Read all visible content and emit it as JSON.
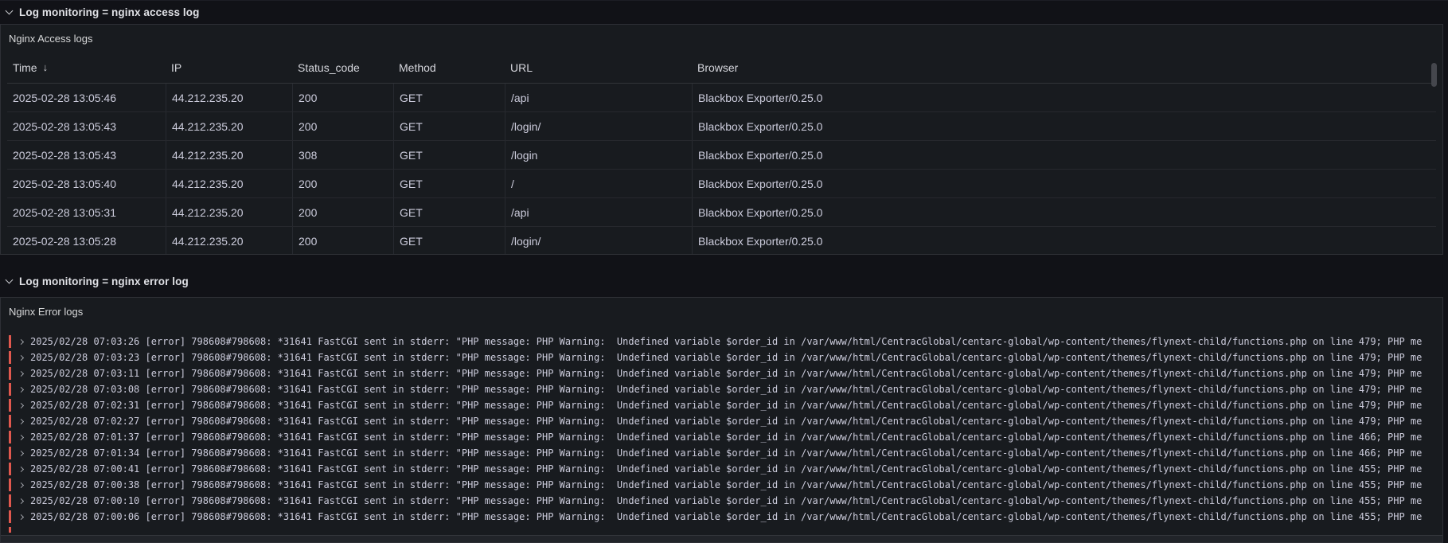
{
  "colors": {
    "error_level_bar": "#e0584e",
    "panel_background": "#181b1f",
    "page_background": "#111217"
  },
  "icons": {
    "sort_desc": "↓",
    "row_chevron": "chevron-down",
    "log_chevron": "chevron-right"
  },
  "access_section": {
    "row_header": "Log monitoring = nginx access log",
    "panel_title": "Nginx Access logs",
    "table": {
      "columns": [
        "Time",
        "IP",
        "Status_code",
        "Method",
        "URL",
        "Browser"
      ],
      "sorted_column_index": 0,
      "sort_direction": "desc",
      "rows": [
        [
          "2025-02-28 13:05:46",
          "44.212.235.20",
          "200",
          "GET",
          "/api",
          "Blackbox Exporter/0.25.0"
        ],
        [
          "2025-02-28 13:05:43",
          "44.212.235.20",
          "200",
          "GET",
          "/login/",
          "Blackbox Exporter/0.25.0"
        ],
        [
          "2025-02-28 13:05:43",
          "44.212.235.20",
          "308",
          "GET",
          "/login",
          "Blackbox Exporter/0.25.0"
        ],
        [
          "2025-02-28 13:05:40",
          "44.212.235.20",
          "200",
          "GET",
          "/",
          "Blackbox Exporter/0.25.0"
        ],
        [
          "2025-02-28 13:05:31",
          "44.212.235.20",
          "200",
          "GET",
          "/api",
          "Blackbox Exporter/0.25.0"
        ],
        [
          "2025-02-28 13:05:28",
          "44.212.235.20",
          "200",
          "GET",
          "/login/",
          "Blackbox Exporter/0.25.0"
        ]
      ]
    }
  },
  "error_section": {
    "row_header": "Log monitoring = nginx error log",
    "panel_title": "Nginx Error logs",
    "log_level": "error",
    "lines": [
      "2025/02/28 07:03:26 [error] 798608#798608: *31641 FastCGI sent in stderr: \"PHP message: PHP Warning:  Undefined variable $order_id in /var/www/html/CentracGlobal/centarc-global/wp-content/themes/flynext-child/functions.php on line 479; PHP me",
      "2025/02/28 07:03:23 [error] 798608#798608: *31641 FastCGI sent in stderr: \"PHP message: PHP Warning:  Undefined variable $order_id in /var/www/html/CentracGlobal/centarc-global/wp-content/themes/flynext-child/functions.php on line 479; PHP me",
      "2025/02/28 07:03:11 [error] 798608#798608: *31641 FastCGI sent in stderr: \"PHP message: PHP Warning:  Undefined variable $order_id in /var/www/html/CentracGlobal/centarc-global/wp-content/themes/flynext-child/functions.php on line 479; PHP me",
      "2025/02/28 07:03:08 [error] 798608#798608: *31641 FastCGI sent in stderr: \"PHP message: PHP Warning:  Undefined variable $order_id in /var/www/html/CentracGlobal/centarc-global/wp-content/themes/flynext-child/functions.php on line 479; PHP me",
      "2025/02/28 07:02:31 [error] 798608#798608: *31641 FastCGI sent in stderr: \"PHP message: PHP Warning:  Undefined variable $order_id in /var/www/html/CentracGlobal/centarc-global/wp-content/themes/flynext-child/functions.php on line 479; PHP me",
      "2025/02/28 07:02:27 [error] 798608#798608: *31641 FastCGI sent in stderr: \"PHP message: PHP Warning:  Undefined variable $order_id in /var/www/html/CentracGlobal/centarc-global/wp-content/themes/flynext-child/functions.php on line 479; PHP me",
      "2025/02/28 07:01:37 [error] 798608#798608: *31641 FastCGI sent in stderr: \"PHP message: PHP Warning:  Undefined variable $order_id in /var/www/html/CentracGlobal/centarc-global/wp-content/themes/flynext-child/functions.php on line 466; PHP me",
      "2025/02/28 07:01:34 [error] 798608#798608: *31641 FastCGI sent in stderr: \"PHP message: PHP Warning:  Undefined variable $order_id in /var/www/html/CentracGlobal/centarc-global/wp-content/themes/flynext-child/functions.php on line 466; PHP me",
      "2025/02/28 07:00:41 [error] 798608#798608: *31641 FastCGI sent in stderr: \"PHP message: PHP Warning:  Undefined variable $order_id in /var/www/html/CentracGlobal/centarc-global/wp-content/themes/flynext-child/functions.php on line 455; PHP me",
      "2025/02/28 07:00:38 [error] 798608#798608: *31641 FastCGI sent in stderr: \"PHP message: PHP Warning:  Undefined variable $order_id in /var/www/html/CentracGlobal/centarc-global/wp-content/themes/flynext-child/functions.php on line 455; PHP me",
      "2025/02/28 07:00:10 [error] 798608#798608: *31641 FastCGI sent in stderr: \"PHP message: PHP Warning:  Undefined variable $order_id in /var/www/html/CentracGlobal/centarc-global/wp-content/themes/flynext-child/functions.php on line 455; PHP me",
      "2025/02/28 07:00:06 [error] 798608#798608: *31641 FastCGI sent in stderr: \"PHP message: PHP Warning:  Undefined variable $order_id in /var/www/html/CentracGlobal/centarc-global/wp-content/themes/flynext-child/functions.php on line 455; PHP me"
    ],
    "has_partial_next_line": true
  }
}
